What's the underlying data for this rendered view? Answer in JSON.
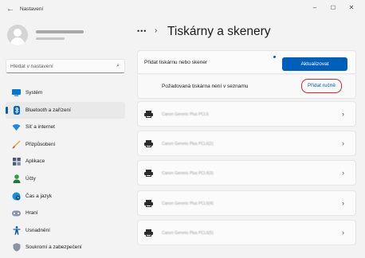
{
  "window": {
    "back_glyph": "←",
    "title": "Nastavení",
    "minimize_glyph": "–",
    "maximize_glyph": "☐",
    "close_glyph": "✕"
  },
  "account": {
    "name": "",
    "email": ""
  },
  "search": {
    "placeholder": "Hledat v nastavení",
    "icon": "search-icon",
    "glyph": "⌕"
  },
  "sidebar": {
    "items": [
      {
        "label": "Systém",
        "icon": "monitor-icon",
        "active": false
      },
      {
        "label": "Bluetooth a zařízení",
        "icon": "bluetooth-icon",
        "active": true
      },
      {
        "label": "Síť a internet",
        "icon": "network-icon",
        "active": false
      },
      {
        "label": "Přizpůsobení",
        "icon": "brush-icon",
        "active": false
      },
      {
        "label": "Aplikace",
        "icon": "apps-icon",
        "active": false
      },
      {
        "label": "Účty",
        "icon": "person-icon",
        "active": false
      },
      {
        "label": "Čas a jazyk",
        "icon": "globe-clock-icon",
        "active": false
      },
      {
        "label": "Hraní",
        "icon": "gamepad-icon",
        "active": false
      },
      {
        "label": "Usnadnění",
        "icon": "accessibility-icon",
        "active": false
      },
      {
        "label": "Soukromí a zabezpečení",
        "icon": "shield-icon",
        "active": false
      }
    ]
  },
  "breadcrumb": {
    "more": "•••",
    "separator": "›",
    "title": "Tiskárny a skenery"
  },
  "add_section": {
    "label": "Přidat tiskárnu nebo skener",
    "update_button": "Aktualizovat",
    "collapse_glyph": "⌃",
    "missing_label": "Požadovaná tiskárna není v seznamu",
    "add_manual_link": "Přidat ručně"
  },
  "printers": [
    {
      "name": "Canon Generic Plus PCL6",
      "chevron": "›"
    },
    {
      "name": "Canon Generic Plus PCL6(2)",
      "chevron": "›"
    },
    {
      "name": "Canon Generic Plus PCL6(3)",
      "chevron": "›"
    },
    {
      "name": "Canon Generic Plus PCL6(4)",
      "chevron": "›"
    },
    {
      "name": "Canon Generic Plus PCL6(5)",
      "chevron": "›"
    }
  ],
  "colors": {
    "accent": "#005fb8",
    "highlight_ring": "#e0262b",
    "background": "#f3f3f3"
  }
}
